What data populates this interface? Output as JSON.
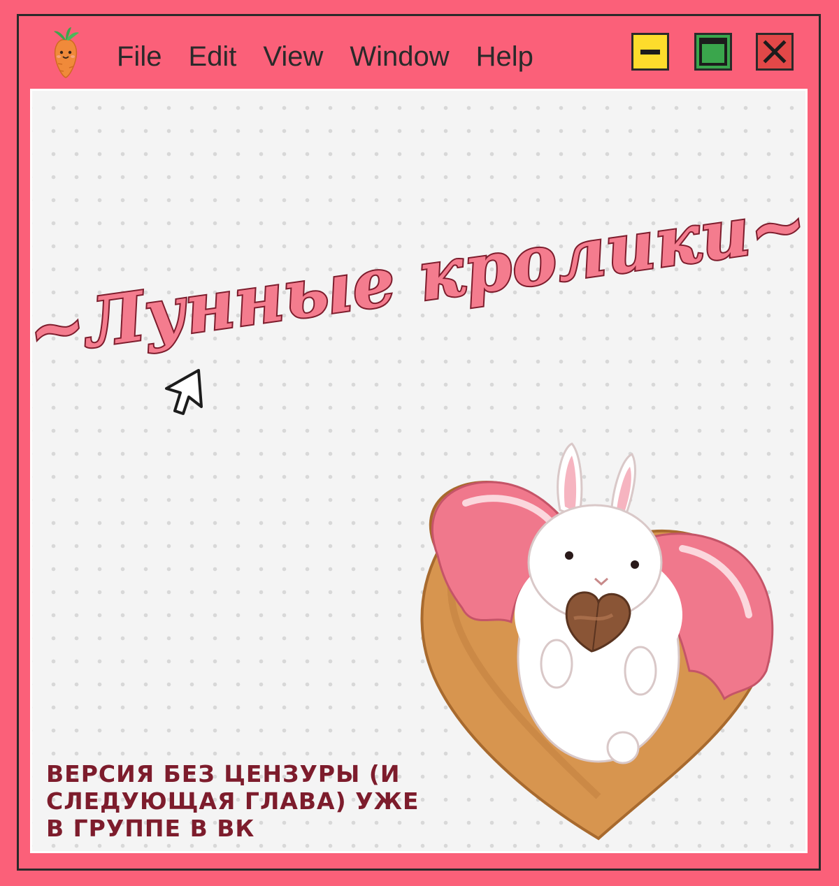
{
  "window": {
    "menu": [
      "File",
      "Edit",
      "View",
      "Window",
      "Help"
    ],
    "controls": {
      "minimize": "minimize-icon",
      "maximize": "maximize-icon",
      "close": "close-icon"
    },
    "app_icon": "carrot-icon"
  },
  "content": {
    "title": "~Лунные кролики~",
    "note": "Версия без цензуры (и следующая глава) уже в группе в ВК",
    "pointer_icon": "cursor-arrow-icon",
    "illustration": "rabbit-heart-donut-illustration"
  },
  "colors": {
    "background": "#fb6079",
    "title_fill": "#f47c8e",
    "title_outline": "#7d1c2c",
    "note_text": "#7d1c2c",
    "minimize": "#fddc2c",
    "maximize": "#3aa64c",
    "close": "#e24848"
  }
}
